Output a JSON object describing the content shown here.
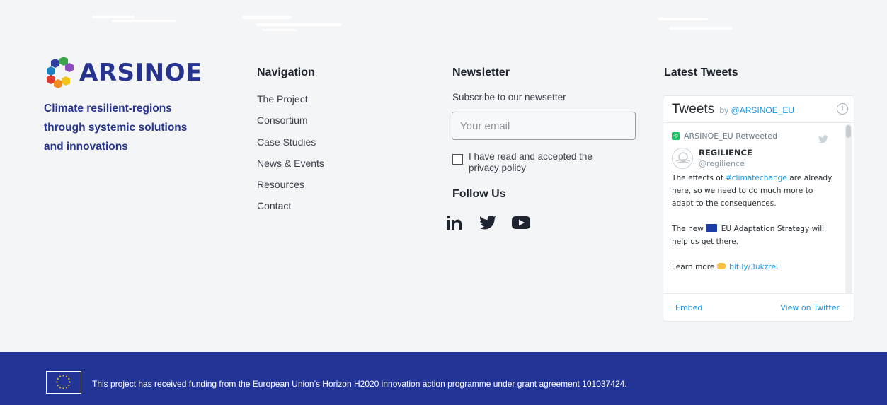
{
  "brand": {
    "name": "ARSINOE",
    "tagline_lines": [
      "Climate resilient-regions",
      "through systemic solutions",
      "and innovations"
    ]
  },
  "navigation": {
    "title": "Navigation",
    "items": [
      "The Project",
      "Consortium",
      "Case Studies",
      "News & Events",
      "Resources",
      "Contact"
    ]
  },
  "newsletter": {
    "title": "Newsletter",
    "subtitle": "Subscribe to our newsetter",
    "email_placeholder": "Your email",
    "consent_text": "I have read and accepted the",
    "consent_link": "privacy policy"
  },
  "follow": {
    "title": "Follow Us",
    "icons": [
      "linkedin-icon",
      "twitter-icon",
      "youtube-icon"
    ]
  },
  "tweets": {
    "section_title": "Latest Tweets",
    "widget_title": "Tweets",
    "by": "by",
    "handle": "@ARSINOE_EU",
    "retweet_label": "ARSINOE_EU Retweeted",
    "author_name": "REGILIENCE",
    "author_handle": "@regilience",
    "text_1a": "The effects of ",
    "hashtag": "#climatechange",
    "text_1b": " are already here, so we need to do much more to adapt to the consequences.",
    "text_2a": "The new ",
    "text_2b": " EU Adaptation Strategy will help us get there.",
    "text_3a": "Learn more ",
    "link": "bit.ly/3ukzreL",
    "embed_label": "Embed",
    "view_label": "View on Twitter"
  },
  "footer": {
    "funding_text": "This project has received funding from the European Union’s Horizon H2020 innovation action programme under grant agreement 101037424."
  },
  "colors": {
    "brand_blue": "#26348f",
    "footer_blue": "#233497",
    "twitter_blue": "#1b95e0",
    "background": "#f4f5f7"
  }
}
